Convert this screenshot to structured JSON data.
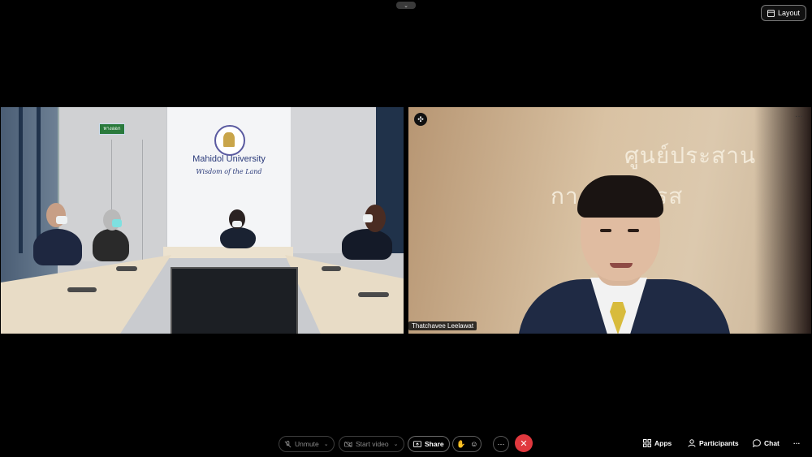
{
  "top": {
    "layout_label": "Layout",
    "handle_glyph": "⌄"
  },
  "left_tile": {
    "banner_title": "Mahidol University",
    "banner_motto": "Wisdom of the Land",
    "exit_sign": "ทางออก"
  },
  "right_tile": {
    "participant_name": "Thatchavee Leelawat",
    "wall_text_line1": "ศูนย์ประสาน",
    "wall_text_line2": "กา    บุรี นครส",
    "more_glyph": "···"
  },
  "toolbar": {
    "unmute_label": "Unmute",
    "start_video_label": "Start video",
    "share_label": "Share",
    "more_glyph": "···",
    "end_glyph": "✕"
  },
  "right_toolbar": {
    "apps_label": "Apps",
    "participants_label": "Participants",
    "chat_label": "Chat",
    "more_glyph": "···"
  },
  "colors": {
    "end_call": "#e0383e",
    "background": "#000000",
    "tie": "#d8bb3c"
  }
}
